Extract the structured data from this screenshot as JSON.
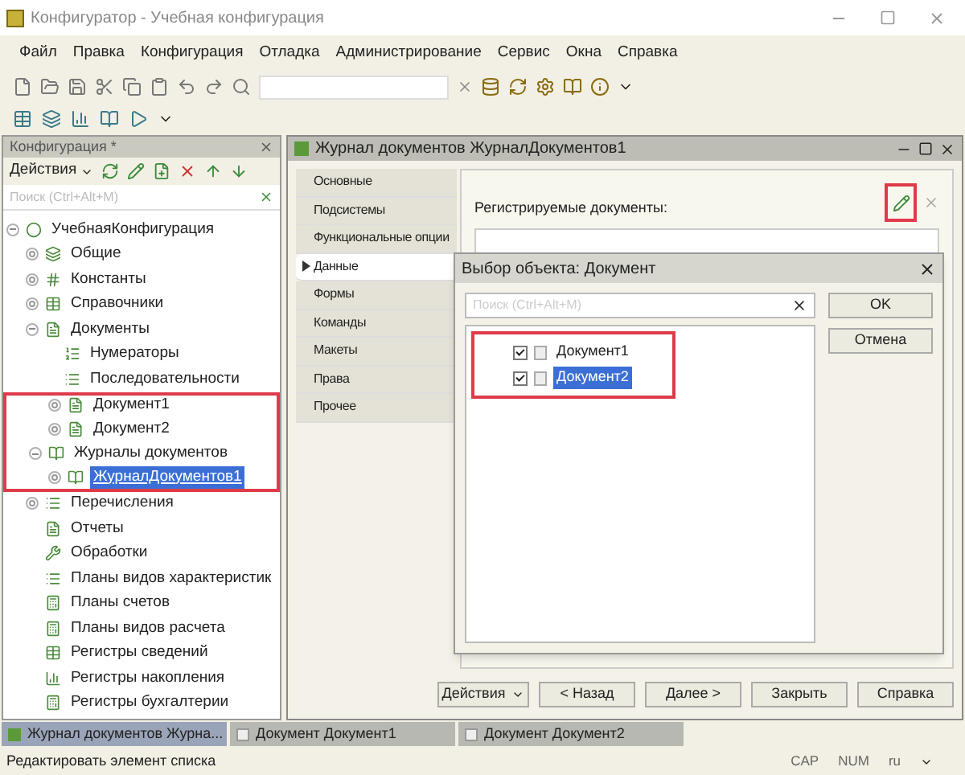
{
  "window": {
    "title": "Конфигуратор - Учебная конфигурация"
  },
  "menu": [
    "Файл",
    "Правка",
    "Конфигурация",
    "Отладка",
    "Администрирование",
    "Сервис",
    "Окна",
    "Справка"
  ],
  "config_panel": {
    "title": "Конфигурация *",
    "actions": "Действия",
    "search": {
      "placeholder": "Поиск (Ctrl+Alt+M)"
    },
    "tree": [
      {
        "label": "УчебнаяКонфигурация",
        "expanded": true,
        "selected": false,
        "marked": false,
        "children": [
          {
            "label": "Общие",
            "expanded": false,
            "selected": false,
            "marked": false
          },
          {
            "label": "Константы",
            "expanded": false,
            "selected": false,
            "marked": false
          },
          {
            "label": "Справочники",
            "expanded": false,
            "selected": false,
            "marked": false
          },
          {
            "label": "Документы",
            "expanded": true,
            "selected": false,
            "marked": false,
            "children": [
              {
                "label": "Нумераторы",
                "selected": false,
                "marked": false
              },
              {
                "label": "Последовательности",
                "selected": false,
                "marked": false
              },
              {
                "label": "Документ1",
                "expanded": false,
                "selected": false,
                "marked": true
              },
              {
                "label": "Документ2",
                "expanded": false,
                "selected": false,
                "marked": true
              }
            ]
          },
          {
            "label": "Журналы документов",
            "expanded": true,
            "selected": false,
            "marked": true,
            "children": [
              {
                "label": "ЖурналДокументов1",
                "expanded": false,
                "selected": true,
                "marked": true
              }
            ]
          },
          {
            "label": "Перечисления",
            "expanded": false,
            "selected": false,
            "marked": false
          },
          {
            "label": "Отчеты",
            "selected": false,
            "marked": false
          },
          {
            "label": "Обработки",
            "selected": false,
            "marked": false
          },
          {
            "label": "Планы видов характеристик",
            "selected": false,
            "marked": false
          },
          {
            "label": "Планы счетов",
            "selected": false,
            "marked": false
          },
          {
            "label": "Планы видов расчета",
            "selected": false,
            "marked": false
          },
          {
            "label": "Регистры сведений",
            "selected": false,
            "marked": false
          },
          {
            "label": "Регистры накопления",
            "selected": false,
            "marked": false
          },
          {
            "label": "Регистры бухгалтерии",
            "selected": false,
            "marked": false
          }
        ]
      }
    ]
  },
  "editor": {
    "title": "Журнал документов ЖурналДокументов1",
    "tabs": [
      {
        "label": "Основные",
        "selected": false
      },
      {
        "label": "Подсистемы",
        "selected": false
      },
      {
        "label": "Функциональные опции",
        "selected": false
      },
      {
        "label": "Данные",
        "selected": true
      },
      {
        "label": "Формы",
        "selected": false
      },
      {
        "label": "Команды",
        "selected": false
      },
      {
        "label": "Макеты",
        "selected": false
      },
      {
        "label": "Права",
        "selected": false
      },
      {
        "label": "Прочее",
        "selected": false
      }
    ],
    "registered_label": "Регистрируемые документы:",
    "buttons": [
      "Действия",
      "< Назад",
      "Далее >",
      "Закрыть",
      "Справка"
    ]
  },
  "dialog": {
    "title": "Выбор объекта: Документ",
    "search": {
      "placeholder": "Поиск (Ctrl+Alt+M)"
    },
    "items": [
      {
        "label": "Документ1",
        "checked": true,
        "selected": false
      },
      {
        "label": "Документ2",
        "checked": true,
        "selected": true
      }
    ],
    "buttons": [
      "OK",
      "Отмена"
    ]
  },
  "taskbar": [
    {
      "label": "Журнал документов Журна...",
      "selected": true
    },
    {
      "label": "Документ Документ1",
      "selected": false
    },
    {
      "label": "Документ Документ2",
      "selected": false
    }
  ],
  "status_bar": {
    "message": "Редактировать элемент списка",
    "indicators": [
      "CAP",
      "NUM",
      "ru"
    ]
  }
}
